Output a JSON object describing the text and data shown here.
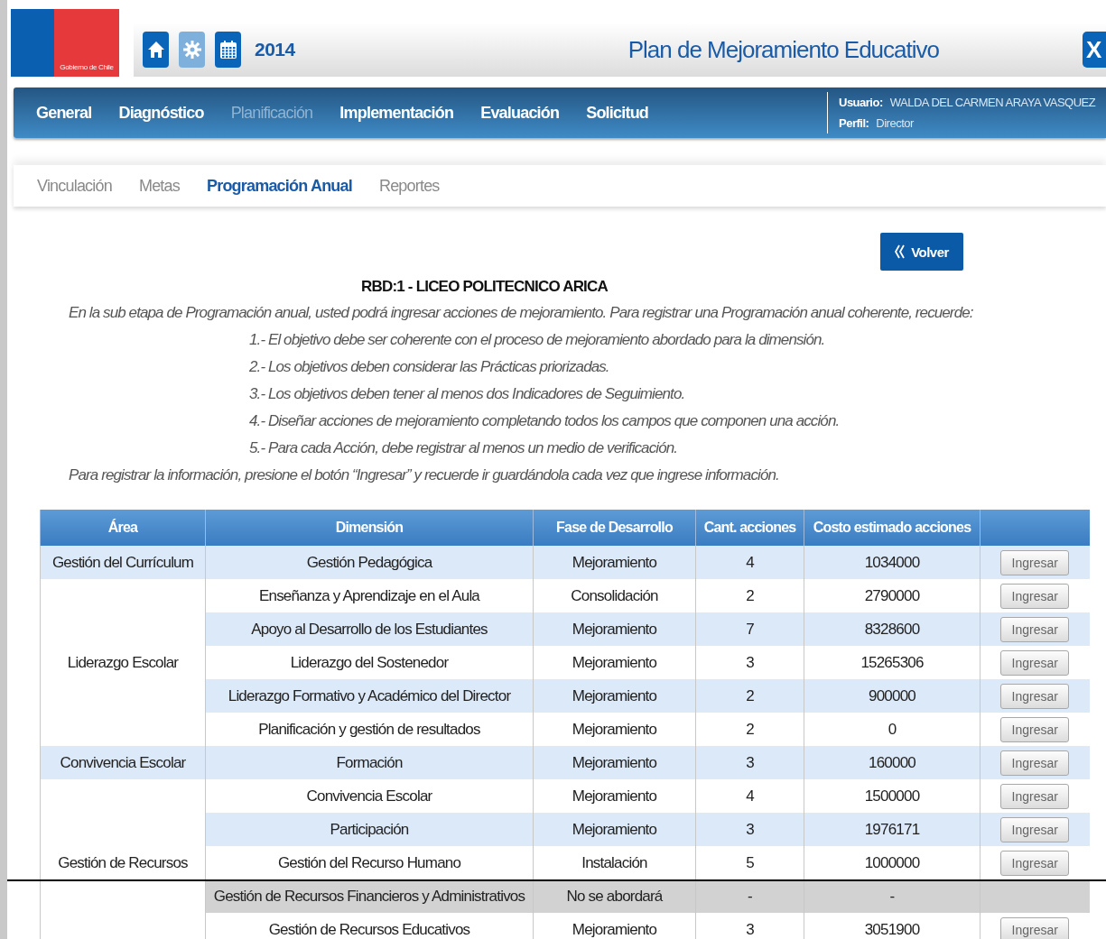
{
  "header": {
    "logo_text": "Gobierno de Chile",
    "year": "2014",
    "title": "Plan de Mejoramiento Educativo",
    "close_label": "X"
  },
  "nav": [
    {
      "label": "General",
      "selected": false
    },
    {
      "label": "Diagnóstico",
      "selected": false
    },
    {
      "label": "Planificación",
      "selected": true
    },
    {
      "label": "Implementación",
      "selected": false
    },
    {
      "label": "Evaluación",
      "selected": false
    },
    {
      "label": "Solicitud",
      "selected": false
    }
  ],
  "user": {
    "user_label": "Usuario:",
    "user_name": "WALDA DEL CARMEN ARAYA VASQUEZ",
    "profile_label": "Perfil:",
    "profile": "Director"
  },
  "subtabs": [
    {
      "label": "Vinculación",
      "selected": false
    },
    {
      "label": "Metas",
      "selected": false
    },
    {
      "label": "Programación Anual",
      "selected": true
    },
    {
      "label": "Reportes",
      "selected": false
    }
  ],
  "back_button": "Volver",
  "school_title": "RBD:1 - LICEO POLITECNICO ARICA",
  "intro": "En la sub etapa de Programación anual, usted podrá ingresar acciones de mejoramiento. Para registrar  una  Programación anual coherente, recuerde:",
  "instructions": [
    "1.- El  objetivo debe ser coherente con el proceso de mejoramiento abordado para la dimensión.",
    "2.- Los objetivos  deben considerar las Prácticas priorizadas.",
    "3.- Los objetivos deben tener al menos dos Indicadores de Seguimiento.",
    "4.-  Diseñar acciones de mejoramiento completando todos los campos que componen una acción.",
    "5.- Para cada Acción, debe registrar al menos un medio de verificación."
  ],
  "note": "Para registrar la información, presione el botón “Ingresar” y recuerde ir guardándola cada vez que ingrese información.",
  "table": {
    "columns": [
      "Área",
      "Dimensión",
      "Fase de Desarrollo",
      "Cant. acciones",
      "Costo estimado acciones"
    ],
    "groups": [
      {
        "area": "Gestión del Currículum",
        "rows": [
          {
            "kind": "active",
            "dimension": "Gestión Pedagógica",
            "phase": "Mejoramiento",
            "count": "4",
            "cost": "1034000",
            "button": "Ingresar"
          },
          {
            "kind": "active",
            "dimension": "Enseñanza y Aprendizaje en el Aula",
            "phase": "Consolidación",
            "count": "2",
            "cost": "2790000",
            "button": "Ingresar"
          },
          {
            "kind": "active",
            "dimension": "Apoyo al Desarrollo de los Estudiantes",
            "phase": "Mejoramiento",
            "count": "7",
            "cost": "8328600",
            "button": "Ingresar"
          }
        ]
      },
      {
        "area": "Liderazgo Escolar",
        "rows": [
          {
            "kind": "active",
            "dimension": "Liderazgo del Sostenedor",
            "phase": "Mejoramiento",
            "count": "3",
            "cost": "15265306",
            "button": "Ingresar"
          },
          {
            "kind": "active",
            "dimension": "Liderazgo Formativo y Académico del Director",
            "phase": "Mejoramiento",
            "count": "2",
            "cost": "900000",
            "button": "Ingresar"
          },
          {
            "kind": "active",
            "dimension": "Planificación y gestión de resultados",
            "phase": "Mejoramiento",
            "count": "2",
            "cost": "0",
            "button": "Ingresar"
          }
        ]
      },
      {
        "area": "Convivencia Escolar",
        "rows": [
          {
            "kind": "active",
            "dimension": "Formación",
            "phase": "Mejoramiento",
            "count": "3",
            "cost": "160000",
            "button": "Ingresar"
          },
          {
            "kind": "active",
            "dimension": "Convivencia Escolar",
            "phase": "Mejoramiento",
            "count": "4",
            "cost": "1500000",
            "button": "Ingresar"
          },
          {
            "kind": "active",
            "dimension": "Participación",
            "phase": "Mejoramiento",
            "count": "3",
            "cost": "1976171",
            "button": "Ingresar"
          }
        ]
      },
      {
        "area": "Gestión de Recursos",
        "rows": [
          {
            "kind": "active",
            "dimension": "Gestión del Recurso Humano",
            "phase": "Instalación",
            "count": "5",
            "cost": "1000000",
            "button": "Ingresar"
          },
          {
            "kind": "skipped",
            "dimension": "Gestión de Recursos Financieros y Administrativos",
            "phase": "No se abordará",
            "count": "-",
            "cost": "-"
          },
          {
            "kind": "active",
            "dimension": "Gestión de Recursos Educativos",
            "phase": "Mejoramiento",
            "count": "3",
            "cost": "3051900",
            "button": "Ingresar"
          }
        ]
      }
    ]
  }
}
